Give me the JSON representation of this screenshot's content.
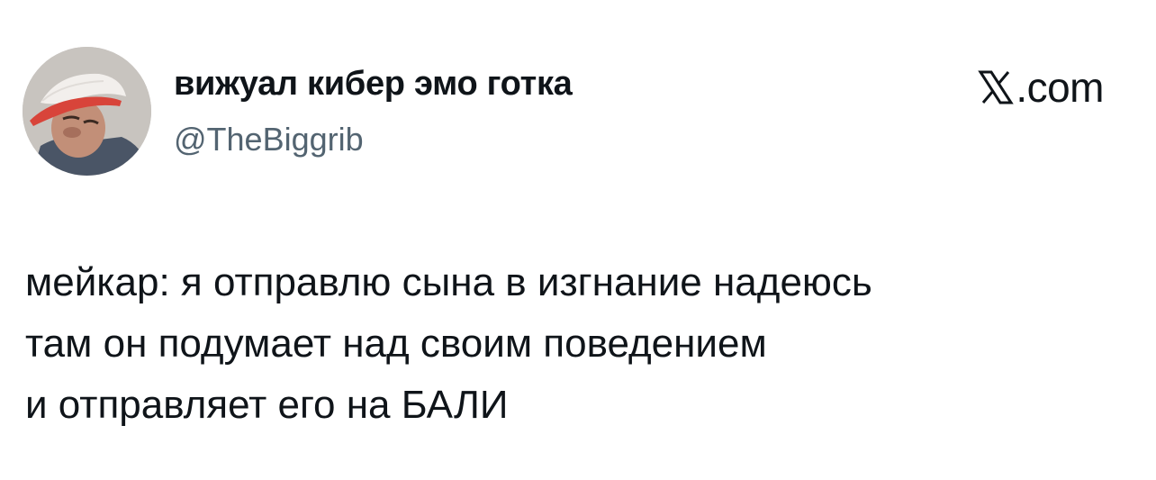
{
  "author": {
    "display_name": "вижуал кибер эмо готка",
    "handle": "@TheBiggrib",
    "avatar_icon": "profile-photo"
  },
  "brand": {
    "icon": "x-logo-icon",
    "suffix": ".com"
  },
  "tweet": {
    "lines": [
      "мейкар: я отправлю сына в изгнание надеюсь",
      "там он подумает над своим поведением",
      "и отправляет его на БАЛИ"
    ]
  }
}
